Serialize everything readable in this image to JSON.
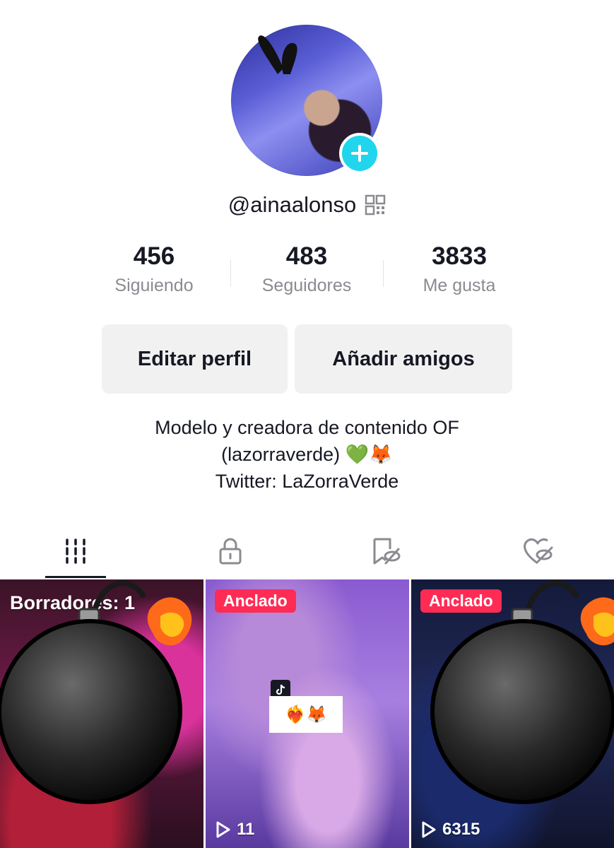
{
  "profile": {
    "username": "@ainaalonso",
    "avatar_icon": "avatar-photo",
    "add_icon": "plus-icon",
    "qr_icon": "qr-code-icon"
  },
  "stats": [
    {
      "value": "456",
      "label": "Siguiendo"
    },
    {
      "value": "483",
      "label": "Seguidores"
    },
    {
      "value": "3833",
      "label": "Me gusta"
    }
  ],
  "actions": {
    "edit_label": "Editar perfil",
    "add_friends_label": "Añadir amigos"
  },
  "bio": {
    "line1": "Modelo y creadora de contenido OF",
    "line2": "(lazorraverde) 💚🦊",
    "line3": "Twitter: LaZorraVerde"
  },
  "tabs": [
    {
      "icon": "videos-grid-icon",
      "active": true
    },
    {
      "icon": "lock-icon",
      "active": false
    },
    {
      "icon": "saved-hidden-icon",
      "active": false
    },
    {
      "icon": "liked-hidden-icon",
      "active": false
    }
  ],
  "videos": [
    {
      "overlay_text": "Borradores: 1",
      "bomb_sticker": true
    },
    {
      "badge": "Anclado",
      "views": "11",
      "sticker_text": "❤️‍🔥🦊"
    },
    {
      "badge": "Anclado",
      "views": "6315",
      "bomb_sticker": true
    }
  ],
  "colors": {
    "accent_cyan": "#20d5ec",
    "badge_red": "#fe2c55",
    "text_primary": "#161823",
    "text_secondary": "#8a8b91",
    "button_bg": "#f1f1f2"
  }
}
